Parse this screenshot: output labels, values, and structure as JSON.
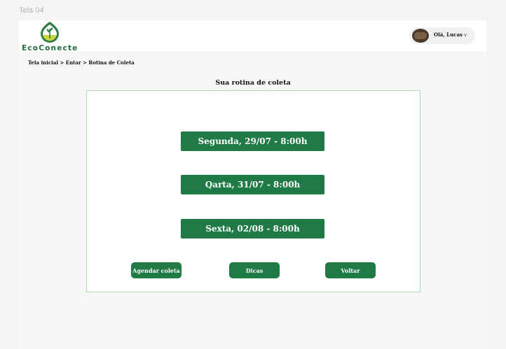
{
  "frame": {
    "label": "Tela 04"
  },
  "header": {
    "brand": "EcoConecte",
    "user": {
      "greeting": "Olá, Lucas",
      "menu_caret": "v"
    }
  },
  "breadcrumb": {
    "home": "Tela inicial",
    "rest": " > Entar > Rotina de Coleta"
  },
  "page": {
    "title": "Sua rotina de coleta",
    "schedule": [
      "Segunda, 29/07 - 8:00h",
      "Qarta, 31/07 - 8:00h",
      "Sexta, 02/08 - 8:00h"
    ],
    "actions": {
      "schedule_label": "Agendar coleta",
      "tips_label": "Dicas",
      "back_label": "Voltar"
    }
  },
  "colors": {
    "brand_green": "#1f7a45",
    "card_border": "#a9dfb0",
    "page_background": "#f5f5f5"
  }
}
